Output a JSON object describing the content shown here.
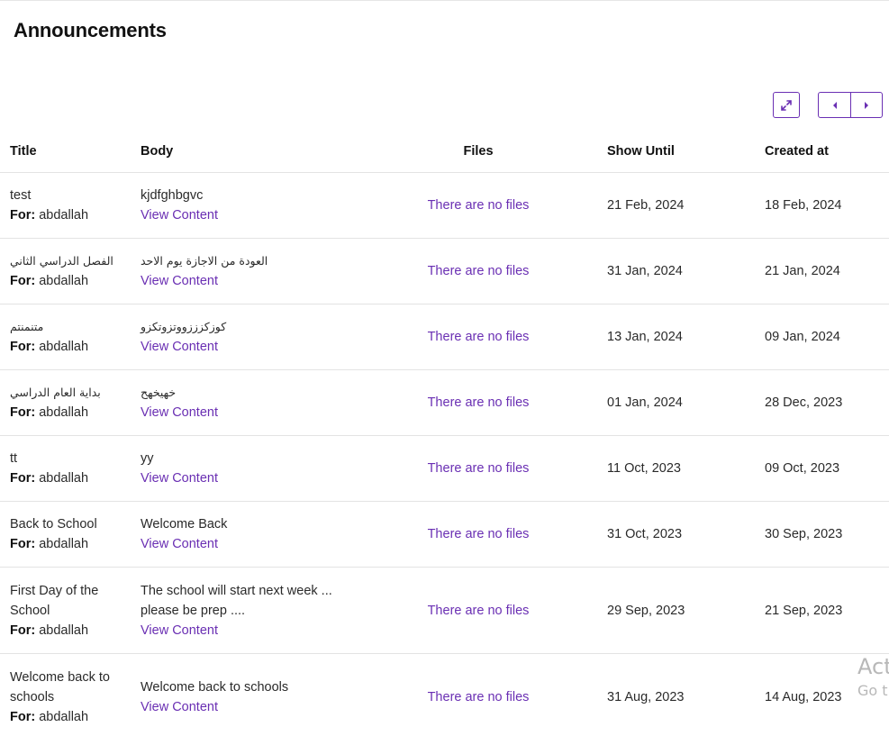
{
  "page": {
    "title": "Announcements"
  },
  "controls": {
    "expand_icon": "expand-icon",
    "prev_icon": "caret-left-icon",
    "next_icon": "caret-right-icon"
  },
  "table": {
    "headers": {
      "title": "Title",
      "body": "Body",
      "files": "Files",
      "show_until": "Show Until",
      "created_at": "Created at"
    },
    "for_label": "For:",
    "view_label": "View Content",
    "rows": [
      {
        "title": "test",
        "for": "abdallah",
        "body": "kjdfghbgvc",
        "files": "There are no files",
        "show_until": "21 Feb, 2024",
        "created_at": "18 Feb, 2024"
      },
      {
        "title": "الفصل الدراسي الثاني",
        "for": "abdallah",
        "body": "العودة من الاجازة يوم الاحد",
        "files": "There are no files",
        "show_until": "31 Jan, 2024",
        "created_at": "21 Jan, 2024"
      },
      {
        "title": "متنمنتم",
        "for": "abdallah",
        "body": "كوزكزززووتزوتكزو",
        "files": "There are no files",
        "show_until": "13 Jan, 2024",
        "created_at": "09 Jan, 2024"
      },
      {
        "title": "بداية العام الدراسي",
        "for": "abdallah",
        "body": "خهيخهح",
        "files": "There are no files",
        "show_until": "01 Jan, 2024",
        "created_at": "28 Dec, 2023"
      },
      {
        "title": "tt",
        "for": "abdallah",
        "body": "yy",
        "files": "There are no files",
        "show_until": "11 Oct, 2023",
        "created_at": "09 Oct, 2023"
      },
      {
        "title": "Back to School",
        "for": "abdallah",
        "body": "Welcome Back",
        "files": "There are no files",
        "show_until": "31 Oct, 2023",
        "created_at": "30 Sep, 2023"
      },
      {
        "title_line1": "First Day of the",
        "title_line2": "School",
        "for": "abdallah",
        "body_line1": "The school will start next week ...",
        "body_line2": "please be prep ....",
        "files": "There are no files",
        "show_until": "29 Sep, 2023",
        "created_at": "21 Sep, 2023"
      },
      {
        "title_line1": "Welcome back to",
        "title_line2": "schools",
        "for": "abdallah",
        "body": "Welcome back to schools",
        "files": "There are no files",
        "show_until": "31 Aug, 2023",
        "created_at": "14 Aug, 2023"
      }
    ]
  },
  "watermark": {
    "line1": "Act",
    "line2": "Go t"
  }
}
